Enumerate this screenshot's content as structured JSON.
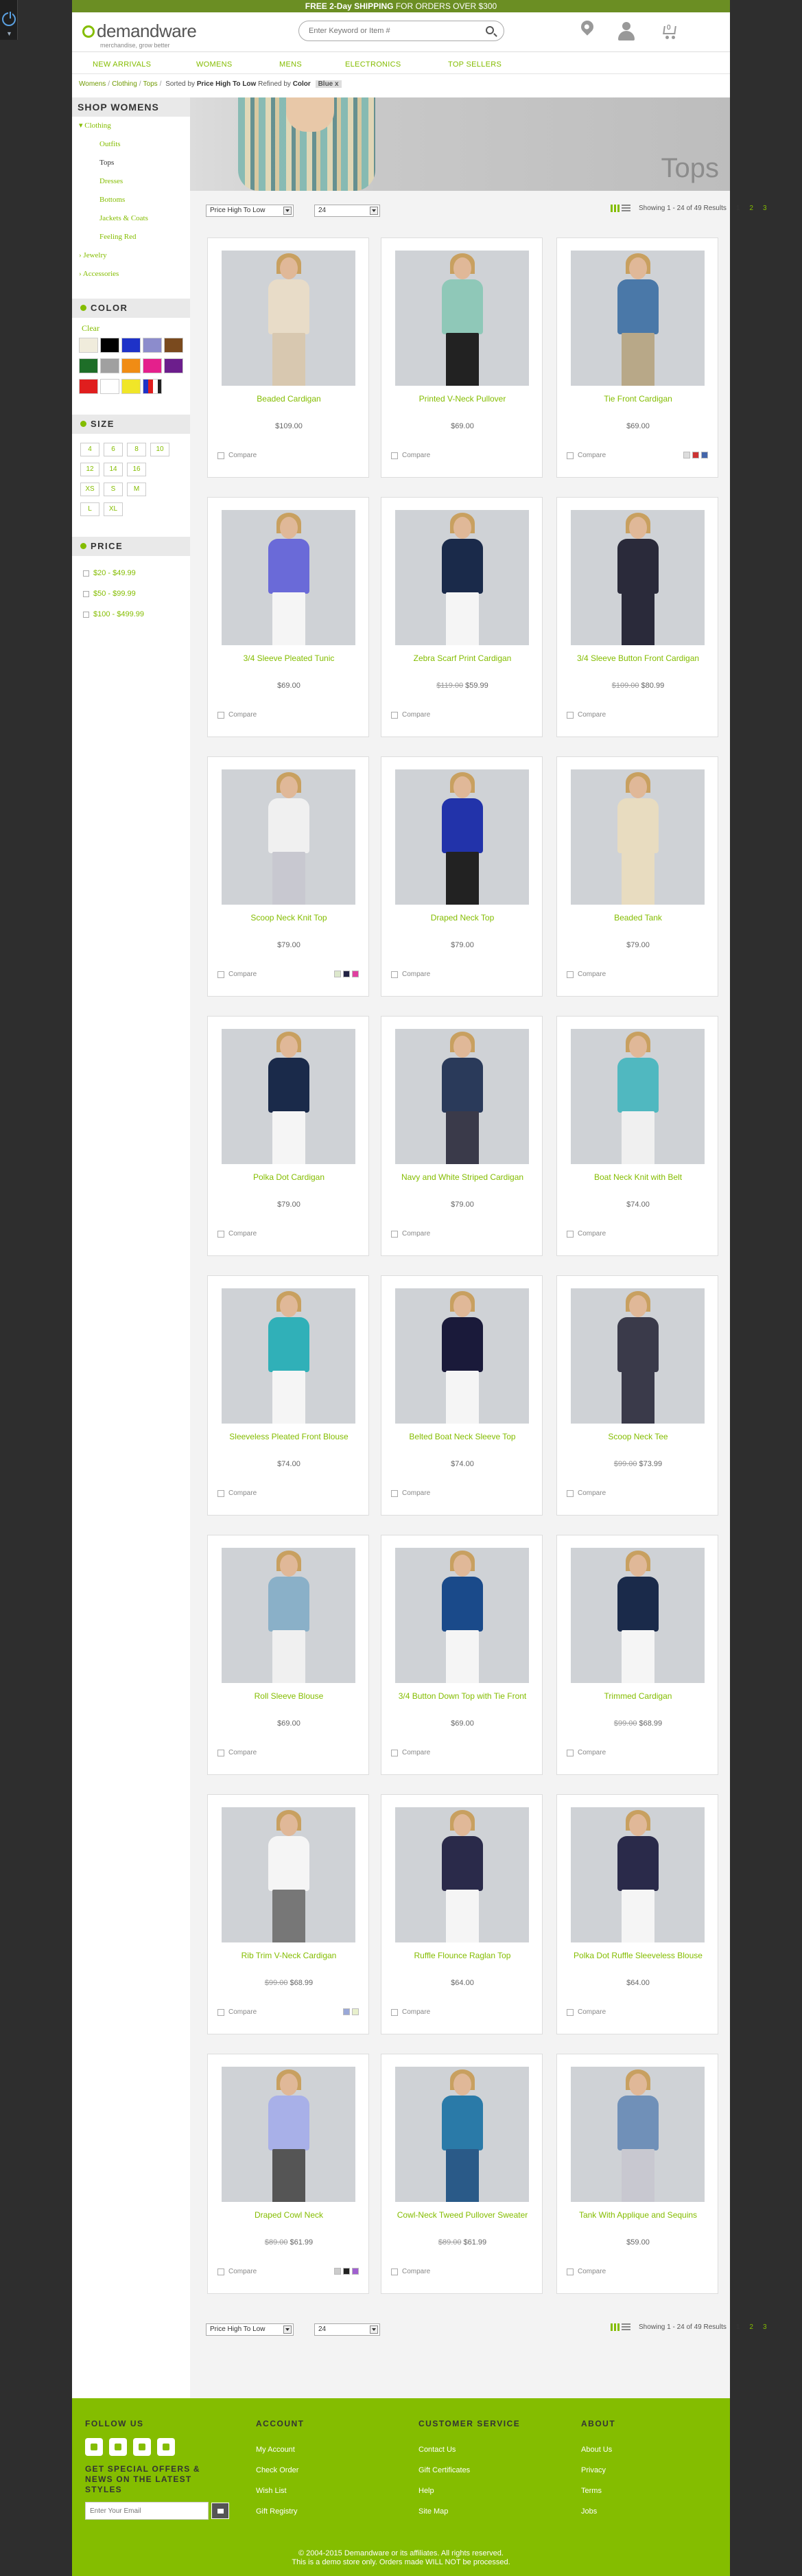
{
  "promo": {
    "bold": "FREE 2-Day SHIPPING",
    "rest": " FOR ORDERS OVER $300"
  },
  "header": {
    "logo": "demandware",
    "tagline": "merchandise, grow better",
    "search_placeholder": "Enter Keyword or Item #",
    "cart_count": "0"
  },
  "nav": [
    "NEW ARRIVALS",
    "WOMENS",
    "MENS",
    "ELECTRONICS",
    "TOP SELLERS"
  ],
  "breadcrumb": {
    "items": [
      "Womens",
      "Clothing",
      "Tops"
    ],
    "sorted_label": "Sorted by",
    "sorted_value": "Price High To Low",
    "refined_label": "Refined by",
    "refined_attr": "Color",
    "refined_value": "Blue"
  },
  "banner_title": "Tops",
  "sidebar": {
    "title": "SHOP WOMENS",
    "categories": [
      {
        "label": "Clothing",
        "level": 1
      },
      {
        "label": "Outfits",
        "level": 2
      },
      {
        "label": "Tops",
        "level": 2
      },
      {
        "label": "Dresses",
        "level": 2
      },
      {
        "label": "Bottoms",
        "level": 2
      },
      {
        "label": "Jackets & Coats",
        "level": 2
      },
      {
        "label": "Feeling Red",
        "level": 2
      },
      {
        "label": "Jewelry",
        "level": 1
      },
      {
        "label": "Accessories",
        "level": 1
      }
    ],
    "color_title": "COLOR",
    "clear": "Clear",
    "colors": [
      "#f0ecdc",
      "#000000",
      "#1e32c8",
      "#8c8ccc",
      "#7a4a1e",
      "#1e6e28",
      "#a0a0a0",
      "#f08c14",
      "#e4208c",
      "#6c1e8c",
      "#e01e1e",
      "#ffffff",
      "#f0e628"
    ],
    "size_title": "SIZE",
    "sizes": [
      "4",
      "6",
      "8",
      "10",
      "12",
      "14",
      "16",
      "XS",
      "S",
      "M",
      "L",
      "XL"
    ],
    "price_title": "PRICE",
    "prices": [
      "$20 - $49.99",
      "$50 - $99.99",
      "$100 - $499.99"
    ]
  },
  "toolbar": {
    "sort": "Price High To Low",
    "per_page": "24",
    "showing": "Showing 1 - 24 of 49 Results",
    "pages": [
      "1",
      "2",
      "3"
    ]
  },
  "compare_label": "Compare",
  "products": [
    {
      "name": "Beaded Cardigan",
      "price": "$109.00",
      "old": "",
      "top": "#e8dcc8",
      "bottom": "#d8c8b0",
      "chips": []
    },
    {
      "name": "Printed V-Neck Pullover",
      "price": "$69.00",
      "old": "",
      "top": "#8fc8b8",
      "bottom": "#222222",
      "chips": []
    },
    {
      "name": "Tie Front Cardigan",
      "price": "$69.00",
      "old": "",
      "top": "#4a78a8",
      "bottom": "#b8a888",
      "chips": [
        "#dddddd",
        "#cc3333",
        "#4466aa"
      ]
    },
    {
      "name": "3/4 Sleeve Pleated Tunic",
      "price": "$69.00",
      "old": "",
      "top": "#6a6ad8",
      "bottom": "#f5f5f5",
      "chips": []
    },
    {
      "name": "Zebra Scarf Print Cardigan",
      "price": "$59.99",
      "old": "$119.00",
      "top": "#1a2a4a",
      "bottom": "#f5f5f5",
      "chips": []
    },
    {
      "name": "3/4 Sleeve Button Front Cardigan",
      "price": "$80.99",
      "old": "$109.00",
      "top": "#2a2a3a",
      "bottom": "#2a2a3a",
      "chips": []
    },
    {
      "name": "Scoop Neck Knit Top",
      "price": "$79.00",
      "old": "",
      "top": "#f0f0f0",
      "bottom": "#c8c8d0",
      "chips": [
        "#dde8cc",
        "#222244",
        "#e040a0"
      ]
    },
    {
      "name": "Draped Neck Top",
      "price": "$79.00",
      "old": "",
      "top": "#2233aa",
      "bottom": "#222222",
      "chips": []
    },
    {
      "name": "Beaded Tank",
      "price": "$79.00",
      "old": "",
      "top": "#e8dcc0",
      "bottom": "#e8dcc0",
      "chips": []
    },
    {
      "name": "Polka Dot Cardigan",
      "price": "$79.00",
      "old": "",
      "top": "#1a2a4a",
      "bottom": "#f5f5f5",
      "chips": []
    },
    {
      "name": "Navy and White Striped Cardigan",
      "price": "$79.00",
      "old": "",
      "top": "#2a3a5a",
      "bottom": "#3a3a4a",
      "chips": []
    },
    {
      "name": "Boat Neck Knit with Belt",
      "price": "$74.00",
      "old": "",
      "top": "#50b8c0",
      "bottom": "#f0f0f0",
      "chips": []
    },
    {
      "name": "Sleeveless Pleated Front Blouse",
      "price": "$74.00",
      "old": "",
      "top": "#30b0b8",
      "bottom": "#f5f5f5",
      "chips": []
    },
    {
      "name": "Belted Boat Neck Sleeve Top",
      "price": "$74.00",
      "old": "",
      "top": "#1a1a3a",
      "bottom": "#f5f5f5",
      "chips": []
    },
    {
      "name": "Scoop Neck Tee",
      "price": "$73.99",
      "old": "$99.00",
      "top": "#3a3a4a",
      "bottom": "#3a3a4a",
      "chips": []
    },
    {
      "name": "Roll Sleeve Blouse",
      "price": "$69.00",
      "old": "",
      "top": "#8ab0c8",
      "bottom": "#f0f0f0",
      "chips": []
    },
    {
      "name": "3/4 Button Down Top with Tie Front",
      "price": "$69.00",
      "old": "",
      "top": "#1a4a8a",
      "bottom": "#f5f5f5",
      "chips": []
    },
    {
      "name": "Trimmed Cardigan",
      "price": "$68.99",
      "old": "$99.00",
      "top": "#1a2a4a",
      "bottom": "#f5f5f5",
      "chips": []
    },
    {
      "name": "Rib Trim V-Neck Cardigan",
      "price": "$68.99",
      "old": "$99.00",
      "top": "#f5f5f5",
      "bottom": "#777777",
      "chips": [
        "#9aa8d8",
        "#e8f0cc"
      ]
    },
    {
      "name": "Ruffle Flounce Raglan Top",
      "price": "$64.00",
      "old": "",
      "top": "#2a2a4a",
      "bottom": "#f5f5f5",
      "chips": []
    },
    {
      "name": "Polka Dot Ruffle Sleeveless Blouse",
      "price": "$64.00",
      "old": "",
      "top": "#2a2a4a",
      "bottom": "#f5f5f5",
      "chips": []
    },
    {
      "name": "Draped Cowl Neck",
      "price": "$61.99",
      "old": "$89.00",
      "top": "#a8b0e8",
      "bottom": "#555555",
      "chips": [
        "#cccccc",
        "#222222",
        "#a060d0"
      ]
    },
    {
      "name": "Cowl-Neck Tweed Pullover Sweater",
      "price": "$61.99",
      "old": "$89.00",
      "top": "#2a7aa8",
      "bottom": "#2a5a88",
      "chips": []
    },
    {
      "name": "Tank With Applique and Sequins",
      "price": "$59.00",
      "old": "",
      "top": "#7090b8",
      "bottom": "#c8c8d0",
      "chips": []
    }
  ],
  "footer": {
    "follow": "FOLLOW US",
    "newsletter": "GET SPECIAL OFFERS & NEWS ON THE LATEST STYLES",
    "email_placeholder": "Enter Your Email",
    "account_title": "ACCOUNT",
    "account": [
      "My Account",
      "Check Order",
      "Wish List",
      "Gift Registry"
    ],
    "service_title": "CUSTOMER SERVICE",
    "service": [
      "Contact Us",
      "Gift Certificates",
      "Help",
      "Site Map"
    ],
    "about_title": "ABOUT",
    "about": [
      "About Us",
      "Privacy",
      "Terms",
      "Jobs"
    ],
    "copyright": "© 2004-2015 Demandware or its affiliates. All rights reserved.",
    "demo": "This is a demo store only. Orders made WILL NOT be processed."
  }
}
